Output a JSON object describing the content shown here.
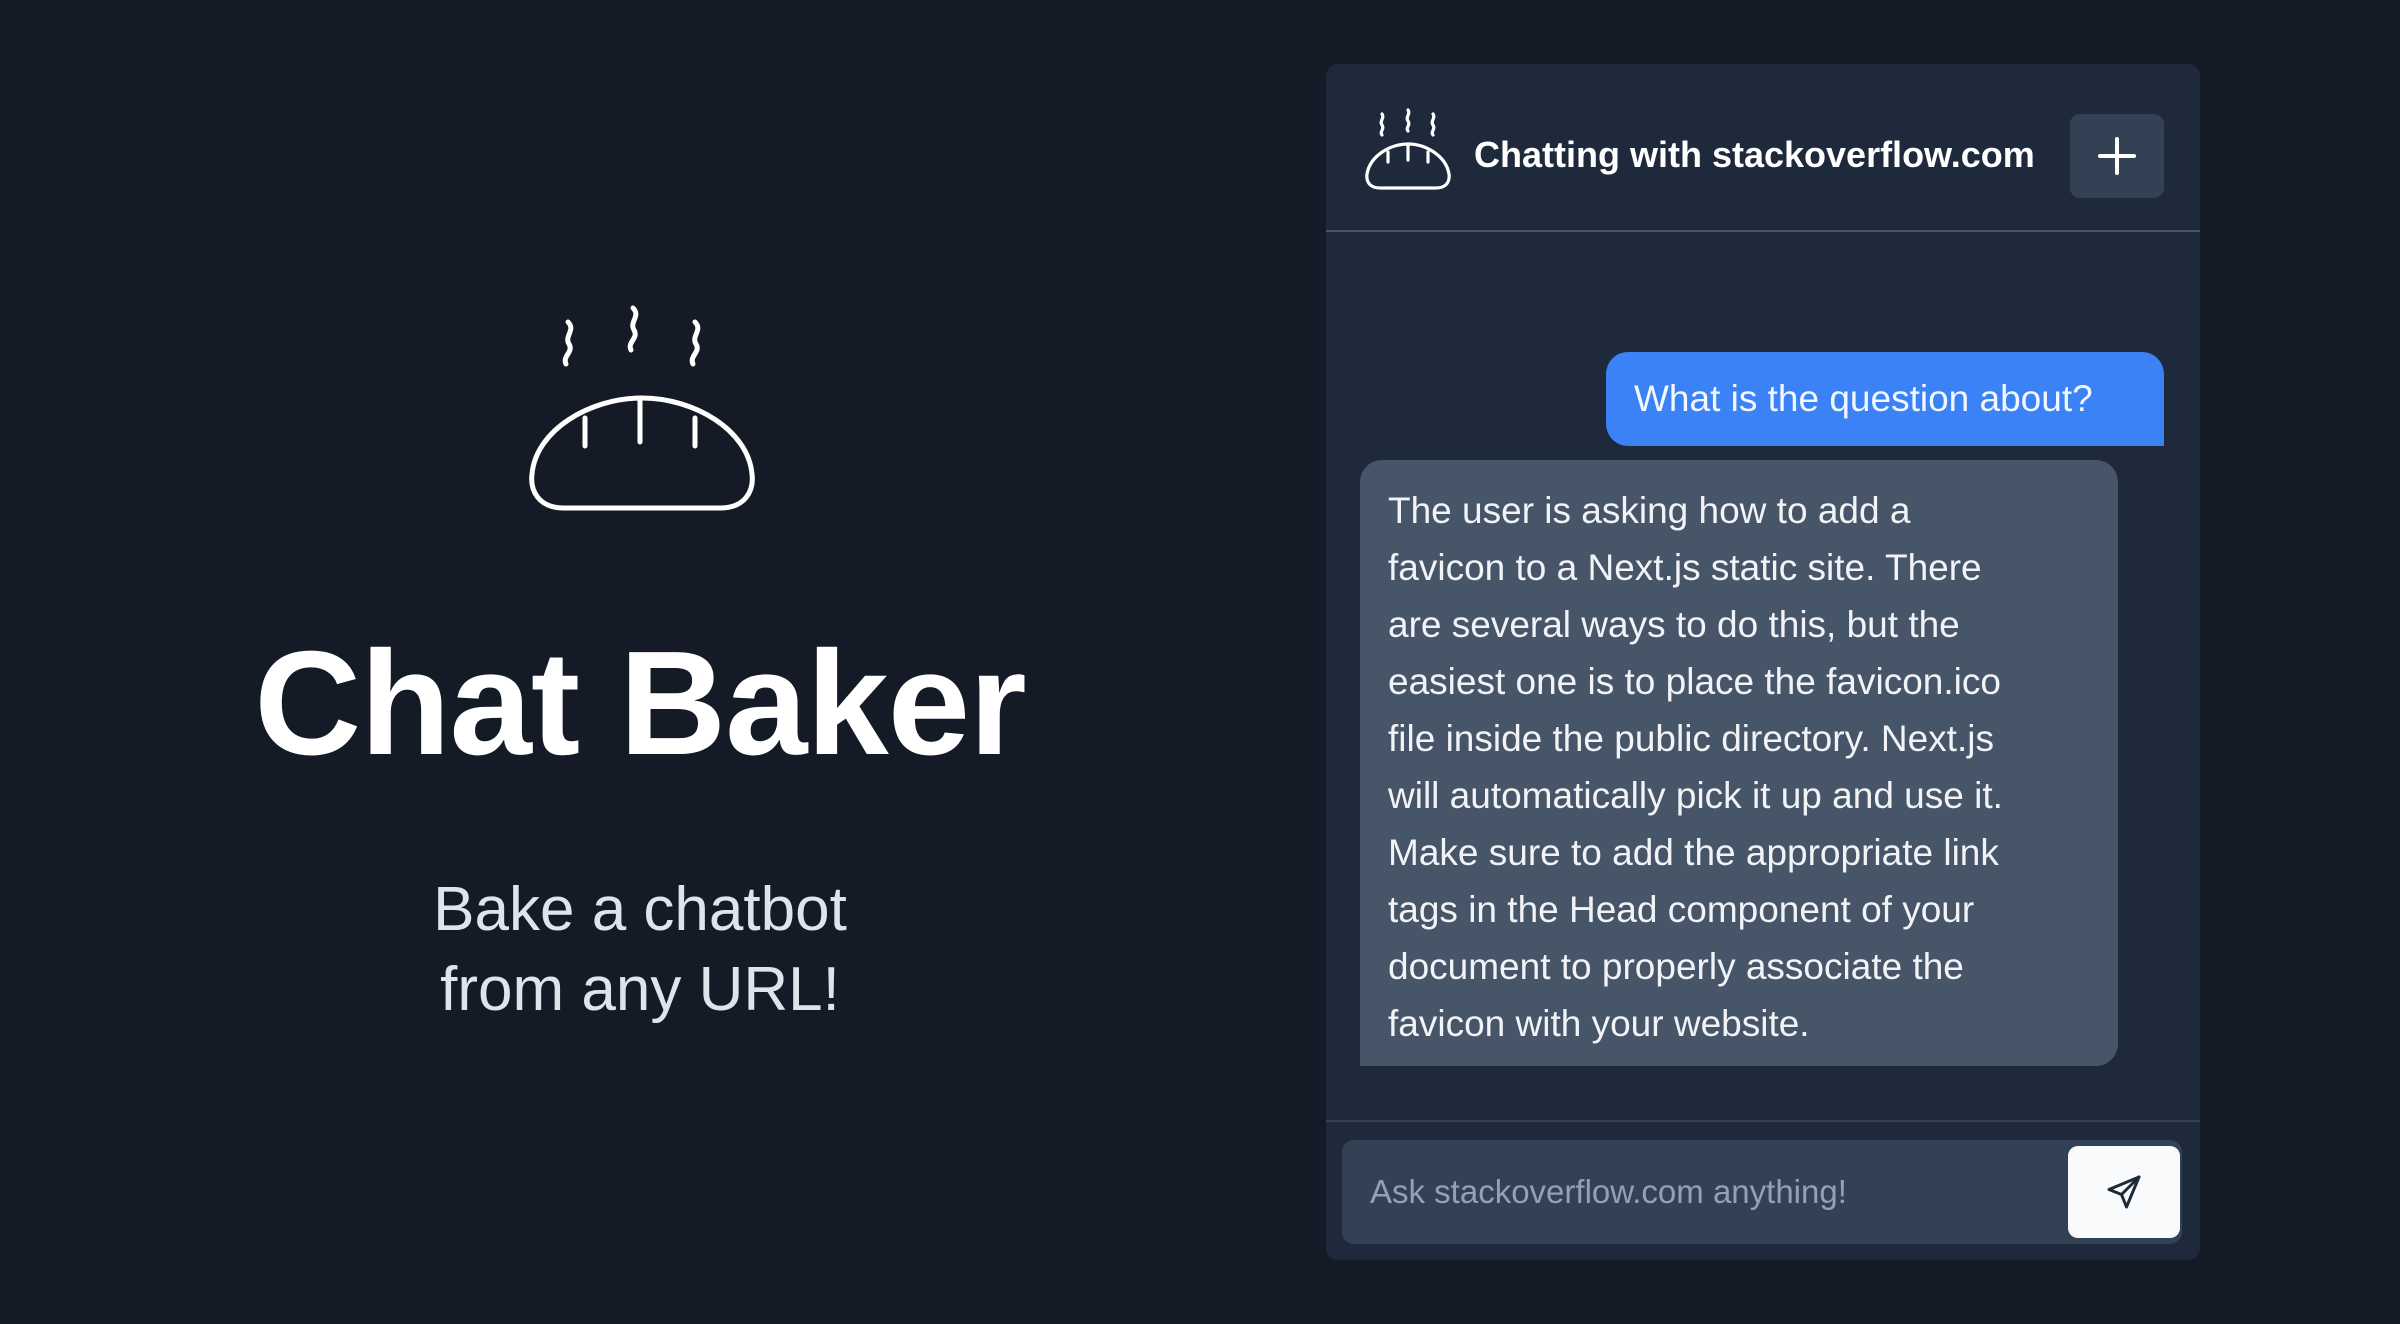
{
  "app": {
    "title": "Chat Baker",
    "subtitle_line1": "Bake a chatbot",
    "subtitle_line2": "from any URL!",
    "logo_icon": "bread-icon"
  },
  "chat": {
    "header_title": "Chatting with stackoverflow.com",
    "header_icon": "bread-icon",
    "new_chat_icon": "plus-icon",
    "messages": [
      {
        "role": "user",
        "text": "What is the question about?"
      },
      {
        "role": "assistant",
        "lines": [
          "The user is asking how to add a",
          "favicon to a Next.js static site. There",
          "are several ways to do this, but the",
          "easiest one is to place the favicon.ico",
          "file inside the public directory. Next.js",
          "will automatically pick it up and use it.",
          "Make sure to add the appropriate link",
          "tags in the Head component of your",
          "document to properly associate the",
          "favicon with your website."
        ]
      }
    ],
    "input_placeholder": "Ask stackoverflow.com anything!",
    "input_value": "",
    "send_icon": "send-icon"
  },
  "colors": {
    "page_bg": "#151b26",
    "panel_bg": "#1e293b",
    "user_bubble": "#3b82f6",
    "assistant_bubble": "#475569",
    "control_bg": "#334155"
  }
}
